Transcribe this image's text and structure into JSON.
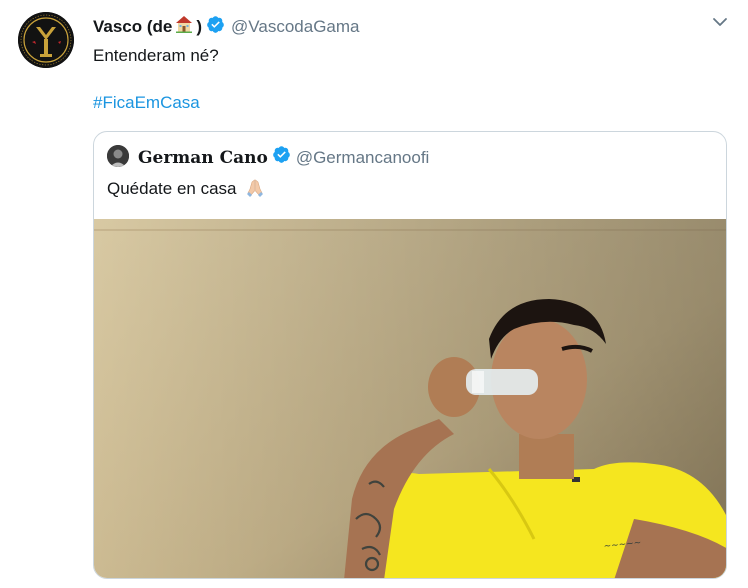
{
  "tweet": {
    "author_name": "Vasco (de",
    "author_name_end": ")",
    "author_handle": "@VascodaGama",
    "text": "Entenderam né?",
    "hashtag": "#FicaEmCasa",
    "avatar_icon": "vasco-crest-icon",
    "name_emoji_icon": "house-icon",
    "verified_icon": "verified-badge-icon",
    "menu_icon": "chevron-down-icon",
    "colors": {
      "link": "#1b95e0",
      "verified": "#1da1f2",
      "secondary_text": "#657786",
      "border": "#ccd6dd",
      "crest_gold": "#c9a23a"
    }
  },
  "quoted_tweet": {
    "author_name": "German Cano",
    "author_handle": "@Germancanoofi",
    "text": "Quédate en casa",
    "text_emoji_icon": "folded-hands-icon",
    "avatar_icon": "profile-photo-icon",
    "verified_icon": "verified-badge-icon",
    "media_icon": "photo-man-drinking-water-icon",
    "colors": {
      "jersey": "#f5e61f",
      "wall": "#c9b78e"
    }
  }
}
